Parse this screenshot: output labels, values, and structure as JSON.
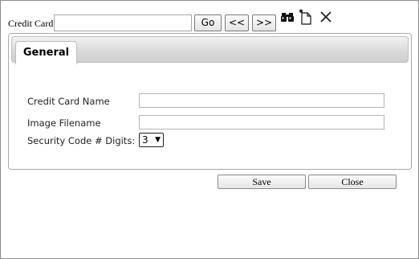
{
  "toolbar": {
    "credit_card_label": "Credit Card:",
    "credit_card_value": "",
    "go_label": "Go",
    "prev_label": "<<",
    "next_label": ">>",
    "icons": [
      "binoculars-icon",
      "new-document-icon",
      "close-icon"
    ]
  },
  "tabs": [
    {
      "label": "General",
      "active": true
    }
  ],
  "form": {
    "name_label": "Credit Card Name",
    "name_value": "",
    "image_label": "Image Filename",
    "image_value": "",
    "digits_label": "Security Code # Digits:",
    "digits_value": "3"
  },
  "actions": {
    "save_label": "Save",
    "close_label": "Close"
  }
}
